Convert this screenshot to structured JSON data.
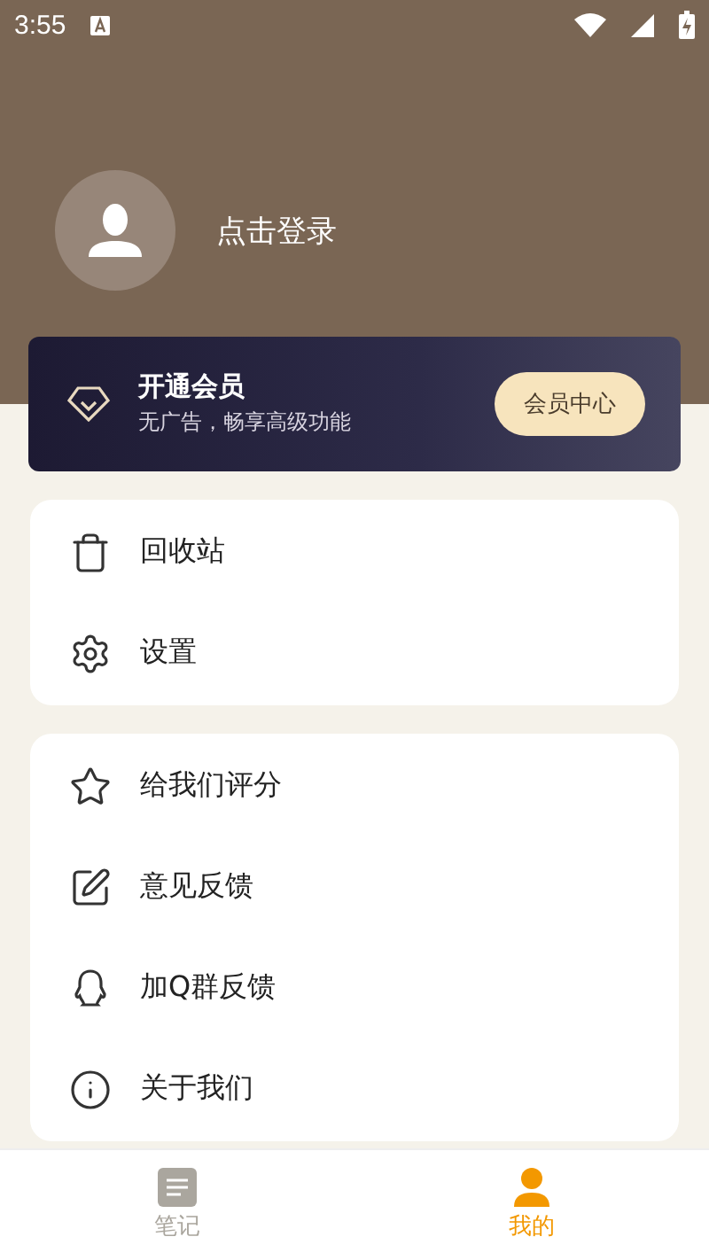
{
  "status_bar": {
    "time": "3:55"
  },
  "profile": {
    "login_label": "点击登录"
  },
  "vip_banner": {
    "title": "开通会员",
    "subtitle": "无广告，畅享高级功能",
    "button": "会员中心"
  },
  "menu_groups": [
    [
      {
        "kind": "trash",
        "label": "回收站"
      },
      {
        "kind": "gear",
        "label": "设置"
      }
    ],
    [
      {
        "kind": "star",
        "label": "给我们评分"
      },
      {
        "kind": "edit",
        "label": "意见反馈"
      },
      {
        "kind": "qq",
        "label": "加Q群反馈"
      },
      {
        "kind": "info",
        "label": "关于我们"
      }
    ]
  ],
  "bottom_nav": [
    {
      "kind": "notes",
      "label": "笔记",
      "selected": false
    },
    {
      "kind": "me",
      "label": "我的",
      "selected": true
    }
  ]
}
